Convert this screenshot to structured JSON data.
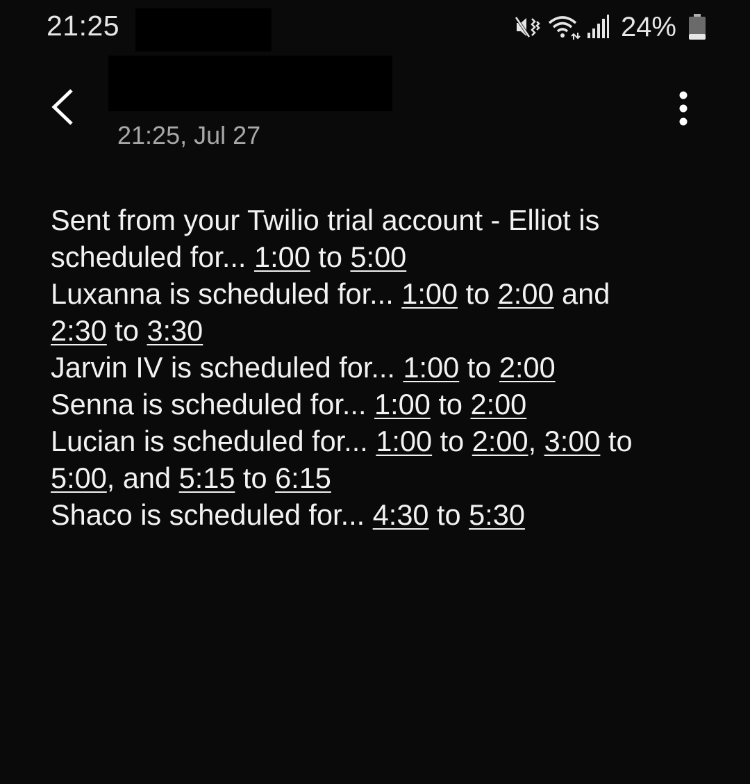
{
  "status_bar": {
    "time": "21:25",
    "battery_percent": "24%",
    "icons": [
      "mute-vibrate-icon",
      "wifi-icon",
      "signal-icon",
      "battery-icon"
    ]
  },
  "header": {
    "timestamp": "21:25, Jul 27",
    "back_icon": "chevron-left-icon",
    "more_icon": "more-vertical-icon"
  },
  "message": {
    "lines": [
      [
        {
          "t": "Sent from your Twilio trial account - Elliot is"
        }
      ],
      [
        {
          "t": "scheduled for... "
        },
        {
          "t": "1:00",
          "link": true
        },
        {
          "t": " to "
        },
        {
          "t": "5:00",
          "link": true
        }
      ],
      [
        {
          "t": "Luxanna is scheduled for... "
        },
        {
          "t": "1:00",
          "link": true
        },
        {
          "t": " to "
        },
        {
          "t": "2:00",
          "link": true
        },
        {
          "t": " and"
        }
      ],
      [
        {
          "t": "2:30",
          "link": true
        },
        {
          "t": " to "
        },
        {
          "t": "3:30",
          "link": true
        }
      ],
      [
        {
          "t": "Jarvin IV is scheduled for... "
        },
        {
          "t": "1:00",
          "link": true
        },
        {
          "t": " to "
        },
        {
          "t": "2:00",
          "link": true
        }
      ],
      [
        {
          "t": "Senna is scheduled for... "
        },
        {
          "t": "1:00",
          "link": true
        },
        {
          "t": " to "
        },
        {
          "t": "2:00",
          "link": true
        }
      ],
      [
        {
          "t": "Lucian is scheduled for... "
        },
        {
          "t": "1:00",
          "link": true
        },
        {
          "t": " to "
        },
        {
          "t": "2:00",
          "link": true
        },
        {
          "t": ", "
        },
        {
          "t": "3:00",
          "link": true
        },
        {
          "t": " to"
        }
      ],
      [
        {
          "t": "5:00",
          "link": true
        },
        {
          "t": ", and "
        },
        {
          "t": "5:15",
          "link": true
        },
        {
          "t": " to "
        },
        {
          "t": "6:15",
          "link": true
        }
      ],
      [
        {
          "t": "Shaco is scheduled for... "
        },
        {
          "t": "4:30",
          "link": true
        },
        {
          "t": " to "
        },
        {
          "t": "5:30",
          "link": true
        }
      ]
    ]
  },
  "colors": {
    "background": "#0a0a0a",
    "text": "#f2f2f2",
    "secondary_text": "#a8a8a8"
  }
}
